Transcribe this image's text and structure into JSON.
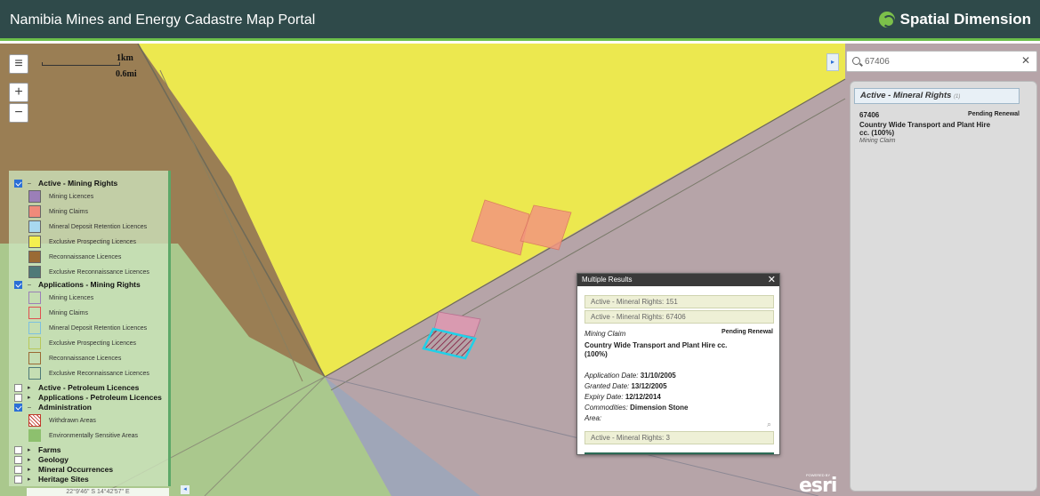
{
  "header": {
    "title": "Namibia Mines and Energy Cadastre Map Portal",
    "brand": "Spatial Dimension"
  },
  "map_controls": {
    "menu_icon": "≡",
    "zoom_in": "+",
    "zoom_out": "−",
    "scale_km": "1km",
    "scale_mi": "0.6mi",
    "coordinates": "22°9'46\" S  14°42'57\" E",
    "left_collapse": "◂",
    "right_collapse": "▸"
  },
  "legend": {
    "groups": [
      {
        "label": "Active - Mining Rights",
        "checked": true,
        "expanded": true,
        "items": [
          {
            "label": "Mining Licences",
            "color": "#9b7fb8"
          },
          {
            "label": "Mining Claims",
            "color": "#f08a7a"
          },
          {
            "label": "Mineral Deposit Retention Licences",
            "color": "#a8d8ef"
          },
          {
            "label": "Exclusive Prospecting Licences",
            "color": "#f4ef4e"
          },
          {
            "label": "Reconnaissance Licences",
            "color": "#9a6a35"
          },
          {
            "label": "Exclusive Reconnaissance Licences",
            "color": "#4f7a78"
          }
        ]
      },
      {
        "label": "Applications - Mining Rights",
        "checked": true,
        "expanded": true,
        "items": [
          {
            "label": "Mining Licences",
            "color": "#9b7fb8"
          },
          {
            "label": "Mining Claims",
            "color": "#e05050"
          },
          {
            "label": "Mineral Deposit Retention Licences",
            "color": "#7cc0e0"
          },
          {
            "label": "Exclusive Prospecting Licences",
            "color": "#b8c85a"
          },
          {
            "label": "Reconnaissance Licences",
            "color": "#9a6a35"
          },
          {
            "label": "Exclusive Reconnaissance Licences",
            "color": "#4f7a78"
          }
        ]
      },
      {
        "label": "Active - Petroleum Licences",
        "checked": false,
        "expanded": false,
        "items": []
      },
      {
        "label": "Applications - Petroleum Licences",
        "checked": false,
        "expanded": false,
        "items": []
      },
      {
        "label": "Administration",
        "checked": true,
        "expanded": true,
        "items": [
          {
            "label": "Withdrawn Areas",
            "color": "#c0392b"
          },
          {
            "label": "Environmentally Sensitive Areas",
            "color": "#8dc06e"
          }
        ]
      },
      {
        "label": "Farms",
        "checked": false,
        "expanded": false,
        "items": []
      },
      {
        "label": "Geology",
        "checked": false,
        "expanded": false,
        "items": []
      },
      {
        "label": "Mineral Occurrences",
        "checked": false,
        "expanded": false,
        "items": []
      },
      {
        "label": "Heritage Sites",
        "checked": false,
        "expanded": false,
        "items": []
      }
    ]
  },
  "popup": {
    "title": "Multiple Results",
    "close": "✕",
    "items": [
      "Active - Mineral Rights: 151",
      "Active - Mineral Rights: 67406"
    ],
    "type": "Mining Claim",
    "status": "Pending Renewal",
    "holder_line1": "Country Wide Transport and Plant Hire cc.",
    "holder_line2": "(100%)",
    "application_label": "Application Date:",
    "application_value": "31/10/2005",
    "granted_label": "Granted Date:",
    "granted_value": "13/12/2005",
    "expiry_label": "Expiry Date:",
    "expiry_value": "12/12/2014",
    "commodities_label": "Commodities:",
    "commodities_value": "Dimension Stone",
    "area_label": "Area:",
    "footer_item": "Active - Mineral Rights: 3"
  },
  "search": {
    "value": "67406",
    "clear": "✕"
  },
  "results": {
    "group_label": "Active - Mineral Rights",
    "group_count": "(1)",
    "id": "67406",
    "status": "Pending Renewal",
    "name_line1": "Country Wide Transport and Plant Hire",
    "name_line2": "cc. (100%)",
    "type": "Mining Claim"
  },
  "map_attribution": {
    "powered": "POWERED BY",
    "esri": "esri"
  }
}
